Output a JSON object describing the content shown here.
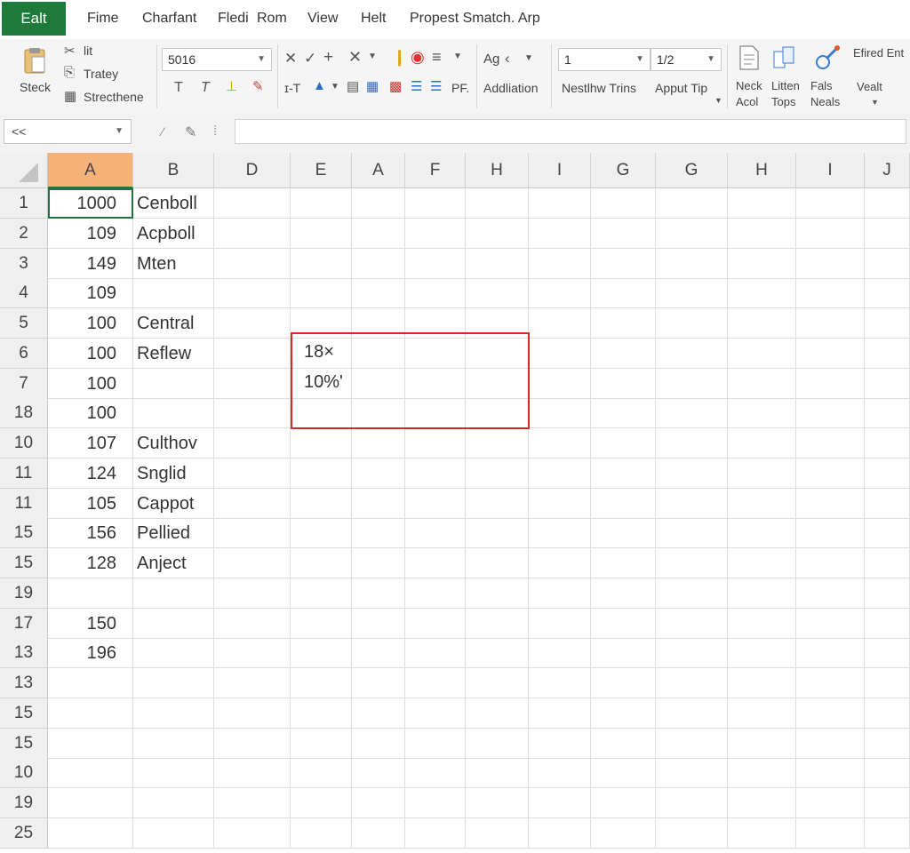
{
  "app_tab": "Ealt",
  "menu": [
    "Fime",
    "Charfant",
    "Fledi",
    "Rom",
    "View",
    "Helt",
    "Propest Smatch. Arp"
  ],
  "ribbon": {
    "stack_label": "Steck",
    "it_label": "lit",
    "tratey_label": "Tratey",
    "strecthene_label": "Strecthene",
    "font_value": "5016",
    "format_row": "ɪ-T",
    "ag_label": "Ag",
    "addliation_label": "Addliation",
    "pf_label": "PF.",
    "number_value": "1",
    "ratio_value": "1/2",
    "nestlhw_label": "Nestlhw Trins",
    "apput_label": "Apput Tip",
    "neck_label": "Neck Acol",
    "litten_label": "Litten Tops",
    "fals_label": "Fals Neals",
    "efired_label": "Efired Ent",
    "vealt_label": "Vealt"
  },
  "formula_bar": {
    "name_box": "<<",
    "value": ""
  },
  "columns": [
    "A",
    "B",
    "D",
    "E",
    "A",
    "F",
    "H",
    "I",
    "G",
    "G",
    "H",
    "I",
    "J"
  ],
  "rows": [
    {
      "num": "1",
      "a": "1000",
      "b": "Cenboll"
    },
    {
      "num": "2",
      "a": "109",
      "b": "Acpboll"
    },
    {
      "num": "3",
      "a": "149",
      "b": "Mten"
    },
    {
      "num": "4",
      "a": "109",
      "b": ""
    },
    {
      "num": "5",
      "a": "100",
      "b": "Central"
    },
    {
      "num": "6",
      "a": "100",
      "b": "Reflew"
    },
    {
      "num": "7",
      "a": "100",
      "b": ""
    },
    {
      "num": "18",
      "a": "100",
      "b": ""
    },
    {
      "num": "10",
      "a": "107",
      "b": "Culthov"
    },
    {
      "num": "11",
      "a": "124",
      "b": "Snglid"
    },
    {
      "num": "11",
      "a": "105",
      "b": "Cappot"
    },
    {
      "num": "15",
      "a": "156",
      "b": "Pellied"
    },
    {
      "num": "15",
      "a": "128",
      "b": "Anject"
    },
    {
      "num": "19",
      "a": "",
      "b": ""
    },
    {
      "num": "17",
      "a": "150",
      "b": ""
    },
    {
      "num": "13",
      "a": "196",
      "b": ""
    },
    {
      "num": "13",
      "a": "",
      "b": ""
    },
    {
      "num": "15",
      "a": "",
      "b": ""
    },
    {
      "num": "15",
      "a": "",
      "b": ""
    },
    {
      "num": "10",
      "a": "",
      "b": ""
    },
    {
      "num": "19",
      "a": "",
      "b": ""
    },
    {
      "num": "25",
      "a": "",
      "b": ""
    }
  ],
  "highlight_box": {
    "line1": "18×",
    "line2": "10%'",
    "color": "#d62a2a"
  },
  "colors": {
    "brand": "#1d7a3a",
    "selected_header": "#f5b37a",
    "active_cell_border": "#217346"
  }
}
